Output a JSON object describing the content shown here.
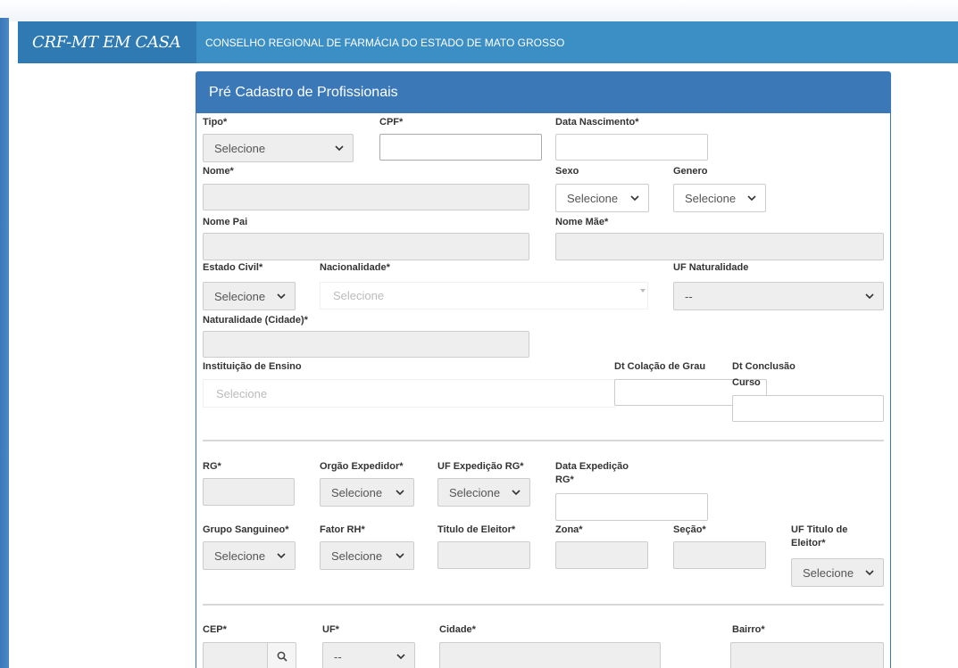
{
  "header": {
    "brand": "CRF-MT EM CASA",
    "title": "CONSELHO REGIONAL DE FARMÁCIA DO ESTADO DE MATO GROSSO"
  },
  "panel": {
    "title": "Pré Cadastro de Profissionais"
  },
  "form": {
    "tipo": {
      "label": "Tipo*",
      "value": "Selecione"
    },
    "cpf": {
      "label": "CPF*"
    },
    "data_nascimento": {
      "label": "Data Nascimento*"
    },
    "nome": {
      "label": "Nome*"
    },
    "sexo": {
      "label": "Sexo",
      "value": "Selecione"
    },
    "genero": {
      "label": "Genero",
      "value": "Selecione"
    },
    "nome_pai": {
      "label": "Nome Pai"
    },
    "nome_mae": {
      "label": "Nome Mãe*"
    },
    "estado_civil": {
      "label": "Estado Civil*",
      "value": "Selecione"
    },
    "nacionalidade": {
      "label": "Nacionalidade*",
      "value": "Selecione"
    },
    "uf_naturalidade": {
      "label": "UF Naturalidade",
      "value": "--"
    },
    "naturalidade": {
      "label": "Naturalidade (Cidade)*"
    },
    "instituicao": {
      "label": "Instituição de Ensino",
      "value": "Selecione"
    },
    "dt_colacao": {
      "label": "Dt Colação de Grau"
    },
    "dt_conclusao": {
      "label_line1": "Dt Conclusão",
      "label_line2": "Curso"
    },
    "rg": {
      "label": "RG*"
    },
    "orgao_expedidor": {
      "label": "Orgão Expedidor*",
      "value": "Selecione"
    },
    "uf_expedicao_rg": {
      "label": "UF Expedição RG*",
      "value": "Selecione"
    },
    "data_expedicao_rg": {
      "label_line1": "Data Expedição",
      "label_line2": "RG*"
    },
    "grupo_sanguineo": {
      "label": "Grupo Sanguineo*",
      "value": "Selecione"
    },
    "fator_rh": {
      "label": "Fator RH*",
      "value": "Selecione"
    },
    "titulo_eleitor": {
      "label": "Titulo de Eleitor*"
    },
    "zona": {
      "label": "Zona*"
    },
    "secao": {
      "label": "Seção*"
    },
    "uf_titulo": {
      "label_line1": "UF Titulo de",
      "label_line2": "Eleitor*",
      "value": "Selecione"
    },
    "cep": {
      "label": "CEP*"
    },
    "uf": {
      "label": "UF*",
      "value": "--"
    },
    "cidade": {
      "label": "Cidade*"
    },
    "bairro": {
      "label": "Bairro*"
    }
  }
}
